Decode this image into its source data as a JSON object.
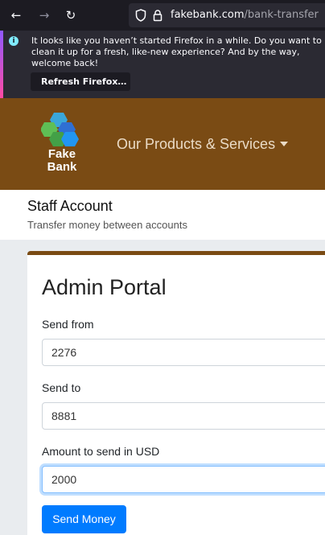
{
  "browser": {
    "url_host": "fakebank.com",
    "url_path": "/bank-transfer"
  },
  "notification": {
    "message": "It looks like you haven’t started Firefox in a while. Do you want to clean it up for a fresh, like-new experience? And by the way, welcome back!",
    "button_label": "Refresh Firefox…"
  },
  "header": {
    "logo_line1": "Fake",
    "logo_line2": "Bank",
    "menu_label": "Our Products & Services",
    "brand_color": "#7a4b14"
  },
  "page": {
    "title": "Staff Account",
    "subtitle": "Transfer money between accounts"
  },
  "form": {
    "title": "Admin Portal",
    "from_label": "Send from",
    "from_value": "2276",
    "to_label": "Send to",
    "to_value": "8881",
    "amount_label": "Amount to send in USD",
    "amount_value": "2000",
    "submit_label": "Send Money"
  }
}
